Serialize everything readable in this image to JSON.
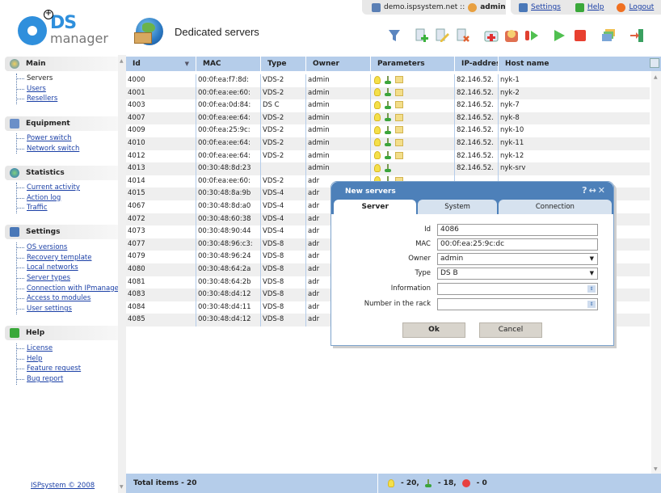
{
  "app": {
    "logo_main": "DS",
    "logo_sub": "manager",
    "page_title": "Dedicated servers"
  },
  "topbar": {
    "host": "demo.ispsystem.net ::",
    "user": "admin",
    "settings": "Settings",
    "help": "Help",
    "logout": "Logout"
  },
  "toolbar": [
    "filter-icon",
    "new-icon",
    "edit-icon",
    "delete-icon",
    "recovery-icon",
    "reboot-icon",
    "restart-icon",
    "power-on-icon",
    "power-off-icon",
    "ip-addresses-icon",
    "exit-icon"
  ],
  "sidebar": {
    "sections": [
      {
        "title": "Main",
        "items": [
          "Servers",
          "Users",
          "Resellers"
        ]
      },
      {
        "title": "Equipment",
        "items": [
          "Power switch",
          "Network switch"
        ]
      },
      {
        "title": "Statistics",
        "items": [
          "Current activity",
          "Action log",
          "Traffic"
        ]
      },
      {
        "title": "Settings",
        "items": [
          "OS versions",
          "Recovery template",
          "Local networks",
          "Server types",
          "Connection with IPmanager",
          "Access to modules",
          "User settings"
        ]
      },
      {
        "title": "Help",
        "items": [
          "License",
          "Help",
          "Feature request",
          "Bug report"
        ]
      }
    ],
    "copyright": "ISPsystem © 2008"
  },
  "grid": {
    "columns": [
      "Id",
      "MAC",
      "Type",
      "Owner",
      "Parameters",
      "IP-addres",
      "Host name"
    ],
    "rows": [
      {
        "id": "4000",
        "mac": "00:0f:ea:f7:8d:",
        "type": "VDS-2",
        "owner": "admin",
        "params": 3,
        "ip": "82.146.52.",
        "host": "nyk-1"
      },
      {
        "id": "4001",
        "mac": "00:0f:ea:ee:60:",
        "type": "VDS-2",
        "owner": "admin",
        "params": 3,
        "ip": "82.146.52.",
        "host": "nyk-2"
      },
      {
        "id": "4003",
        "mac": "00:0f:ea:0d:84:",
        "type": "DS C",
        "owner": "admin",
        "params": 3,
        "ip": "82.146.52.",
        "host": "nyk-7"
      },
      {
        "id": "4007",
        "mac": "00:0f:ea:ee:64:",
        "type": "VDS-2",
        "owner": "admin",
        "params": 3,
        "ip": "82.146.52.",
        "host": "nyk-8"
      },
      {
        "id": "4009",
        "mac": "00:0f:ea:25:9c:",
        "type": "VDS-2",
        "owner": "admin",
        "params": 3,
        "ip": "82.146.52.",
        "host": "nyk-10"
      },
      {
        "id": "4010",
        "mac": "00:0f:ea:ee:64:",
        "type": "VDS-2",
        "owner": "admin",
        "params": 3,
        "ip": "82.146.52.",
        "host": "nyk-11"
      },
      {
        "id": "4012",
        "mac": "00:0f:ea:ee:64:",
        "type": "VDS-2",
        "owner": "admin",
        "params": 3,
        "ip": "82.146.52.",
        "host": "nyk-12"
      },
      {
        "id": "4013",
        "mac": "00:30:48:8d:23",
        "type": "",
        "owner": "admin",
        "params": 2,
        "ip": "82.146.52.",
        "host": "nyk-srv"
      },
      {
        "id": "4014",
        "mac": "00:0f:ea:ee:60:",
        "type": "VDS-2",
        "owner": "adr",
        "params": 3,
        "ip": "",
        "host": ""
      },
      {
        "id": "4015",
        "mac": "00:30:48:8a:9b",
        "type": "VDS-4",
        "owner": "adr",
        "params": 0,
        "ip": "",
        "host": ""
      },
      {
        "id": "4067",
        "mac": "00:30:48:8d:a0",
        "type": "VDS-4",
        "owner": "adr",
        "params": 0,
        "ip": "",
        "host": ""
      },
      {
        "id": "4072",
        "mac": "00:30:48:60:38",
        "type": "VDS-4",
        "owner": "adr",
        "params": 0,
        "ip": "",
        "host": ""
      },
      {
        "id": "4073",
        "mac": "00:30:48:90:44",
        "type": "VDS-4",
        "owner": "adr",
        "params": 0,
        "ip": "",
        "host": ""
      },
      {
        "id": "4077",
        "mac": "00:30:48:96:c3:",
        "type": "VDS-8",
        "owner": "adr",
        "params": 0,
        "ip": "",
        "host": ""
      },
      {
        "id": "4079",
        "mac": "00:30:48:96:24",
        "type": "VDS-8",
        "owner": "adr",
        "params": 0,
        "ip": "",
        "host": ""
      },
      {
        "id": "4080",
        "mac": "00:30:48:64:2a",
        "type": "VDS-8",
        "owner": "adr",
        "params": 0,
        "ip": "",
        "host": ""
      },
      {
        "id": "4081",
        "mac": "00:30:48:64:2b",
        "type": "VDS-8",
        "owner": "adr",
        "params": 0,
        "ip": "",
        "host": ""
      },
      {
        "id": "4083",
        "mac": "00:30:48:d4:12",
        "type": "VDS-8",
        "owner": "adr",
        "params": 0,
        "ip": "",
        "host": ""
      },
      {
        "id": "4084",
        "mac": "00:30:48:d4:11",
        "type": "VDS-8",
        "owner": "adr",
        "params": 0,
        "ip": "",
        "host": ""
      },
      {
        "id": "4085",
        "mac": "00:30:48:d4:12",
        "type": "VDS-8",
        "owner": "adr",
        "params": 0,
        "ip": "",
        "host": ""
      }
    ]
  },
  "footer": {
    "total": "Total items - 20",
    "on": "- 20,",
    "connected": "- 18,",
    "errors": "- 0"
  },
  "dialog": {
    "title": "New servers",
    "controls": "? ↔ ✕",
    "tabs": [
      "Server",
      "System",
      "Connection"
    ],
    "fields": [
      {
        "label": "Id",
        "value": "4086",
        "kind": "text"
      },
      {
        "label": "MAC",
        "value": "00:0f:ea:25:9c:dc",
        "kind": "text"
      },
      {
        "label": "Owner",
        "value": "admin",
        "kind": "select"
      },
      {
        "label": "Type",
        "value": "DS B",
        "kind": "select"
      },
      {
        "label": "Information",
        "value": "",
        "kind": "expand"
      },
      {
        "label": "Number in the rack",
        "value": "",
        "kind": "expand"
      }
    ],
    "ok": "Ok",
    "cancel": "Cancel"
  }
}
